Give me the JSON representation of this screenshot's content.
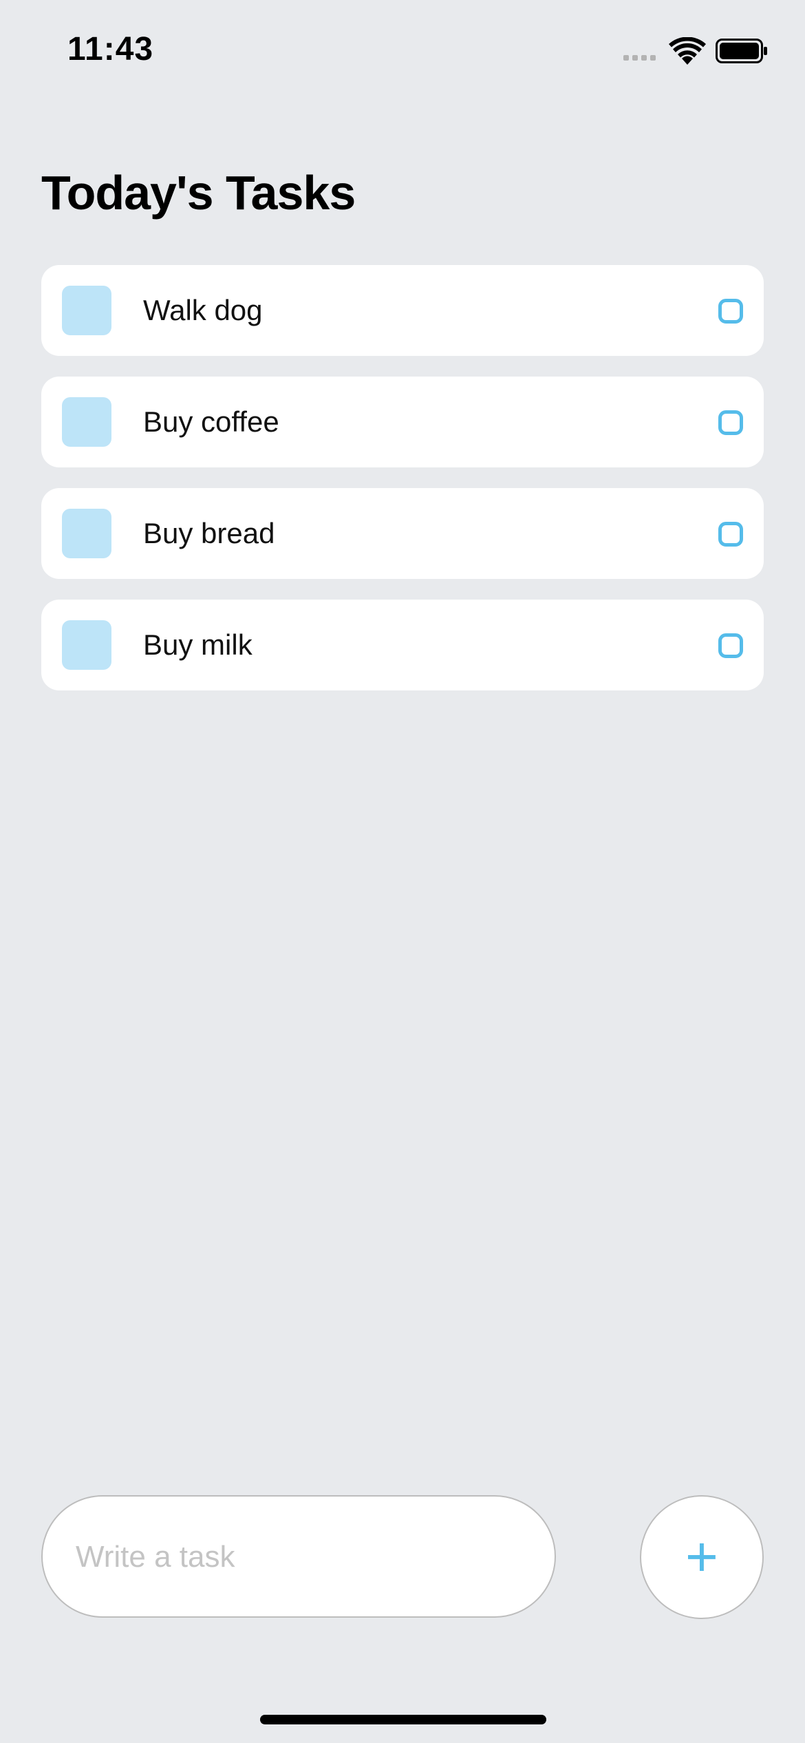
{
  "status_bar": {
    "time": "11:43",
    "icons": [
      "signal-icon",
      "wifi-icon",
      "battery-icon"
    ]
  },
  "header": {
    "title": "Today's Tasks"
  },
  "tasks": [
    {
      "label": "Walk dog",
      "completed": false
    },
    {
      "label": "Buy coffee",
      "completed": false
    },
    {
      "label": "Buy bread",
      "completed": false
    },
    {
      "label": "Buy milk",
      "completed": false
    }
  ],
  "composer": {
    "placeholder": "Write a task",
    "value": "",
    "add_label": "+"
  },
  "colors": {
    "background": "#e8eaed",
    "card": "#ffffff",
    "accent": "#55bcea",
    "square": "#bde4f8"
  }
}
